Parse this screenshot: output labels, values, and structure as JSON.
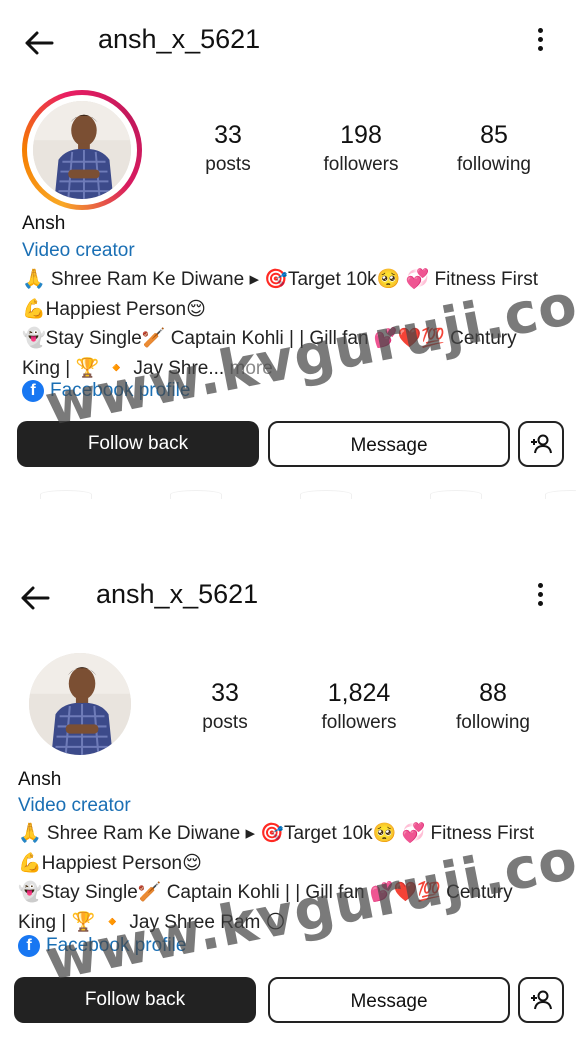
{
  "profiles": [
    {
      "username": "ansh_x_5621",
      "stats": [
        {
          "value": "33",
          "label": "posts"
        },
        {
          "value": "198",
          "label": "followers"
        },
        {
          "value": "85",
          "label": "following"
        }
      ],
      "name": "Ansh",
      "category": "Video creator",
      "bio_lines": [
        "🙏 Shree Ram Ke Diwane ▸ 🎯Target 10k🥺 💞 Fitness First",
        "💪Happiest Person😌",
        "👻Stay Single🏏 Captain Kohli | | Gill fan 💕❤️💯 Century",
        "King | 🏆 🔸 Jay Shre..."
      ],
      "more_label": "more",
      "facebook_label": "Facebook profile",
      "buttons": {
        "follow_back": "Follow back",
        "message": "Message"
      },
      "has_story_ring": true
    },
    {
      "username": "ansh_x_5621",
      "stats": [
        {
          "value": "33",
          "label": "posts"
        },
        {
          "value": "1,824",
          "label": "followers"
        },
        {
          "value": "88",
          "label": "following"
        }
      ],
      "name": "Ansh",
      "category": "Video creator",
      "bio_lines": [
        "🙏 Shree Ram Ke Diwane ▸ 🎯Target 10k🥺 💞 Fitness First",
        "💪Happiest Person😌",
        "👻Stay Single🏏 Captain Kohli | | Gill fan 💕❤️💯 Century",
        "King | 🏆 🔸 Jay Shree Ram 🌕"
      ],
      "more_label": "",
      "facebook_label": "Facebook profile",
      "buttons": {
        "follow_back": "Follow back",
        "message": "Message"
      },
      "has_story_ring": false
    }
  ],
  "icons": {
    "back": "arrow-left-icon",
    "more": "more-vertical-icon",
    "add_person": "add-person-icon",
    "facebook": "facebook-icon"
  },
  "colors": {
    "link_blue": "#1a6fb4",
    "button_dark": "#222222",
    "facebook_blue": "#1877f2"
  },
  "watermark": "www.kvguruji.com"
}
